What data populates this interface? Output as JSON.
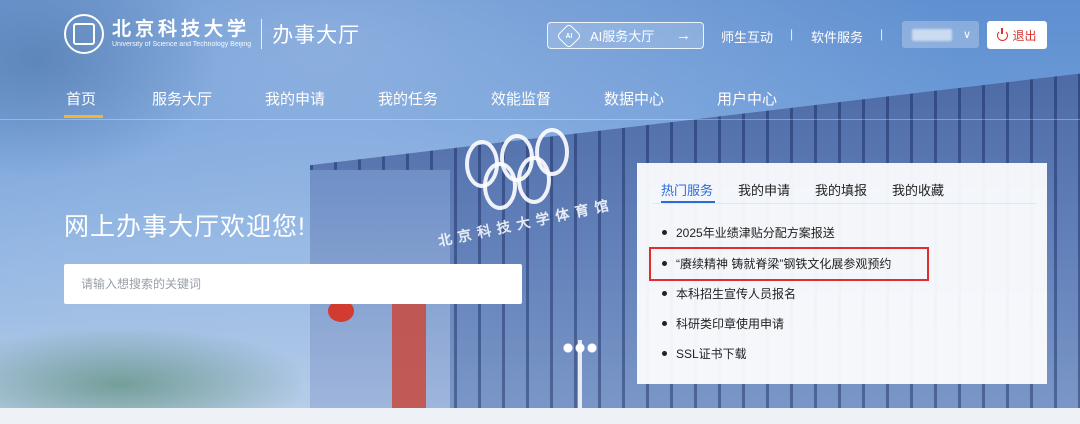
{
  "header": {
    "logo_cn": "北京科技大学",
    "logo_en": "University of Science and Technology Beijing",
    "system_title": "办事大厅",
    "ai_button_label": "AI服务大厅",
    "ai_icon_text": "AI",
    "ai_arrow": "→",
    "links": [
      "师生互动",
      "软件服务"
    ],
    "separators": [
      "|",
      "|"
    ],
    "user_chevron": "∨",
    "logout_label": "退出"
  },
  "nav": {
    "items": [
      "首页",
      "服务大厅",
      "我的申请",
      "我的任务",
      "效能监督",
      "数据中心",
      "用户中心"
    ],
    "active_index": 0
  },
  "hero": {
    "welcome": "网上办事大厅欢迎您!",
    "search_placeholder": "请输入想搜索的关键词",
    "building_text": "北京科技大学体育馆"
  },
  "panel": {
    "tabs": [
      "热门服务",
      "我的申请",
      "我的填报",
      "我的收藏"
    ],
    "active_tab": 0,
    "items": [
      "2025年业绩津贴分配方案报送",
      "“赓续精神 铸就脊梁”钢铁文化展参观预约",
      "本科招生宣传人员报名",
      "科研类印章使用申请",
      "SSL证书下载"
    ],
    "highlighted_index": 1
  },
  "colors": {
    "accent": "#2d6cd8",
    "nav_active": "#f4b52f",
    "logout": "#d9322d",
    "highlight": "#e02d2d"
  },
  "icons": [
    "seal-logo-icon",
    "ai-icon",
    "arrow-right-icon",
    "chevron-down-icon",
    "power-icon"
  ]
}
